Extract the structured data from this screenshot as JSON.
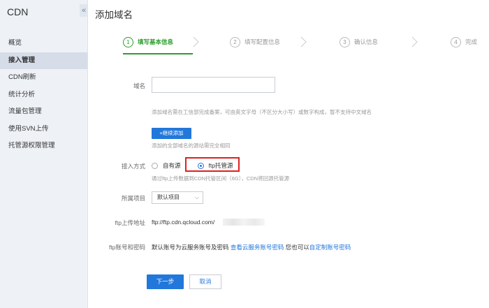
{
  "sidebar": {
    "title": "CDN",
    "collapse_glyph": "«",
    "items": [
      {
        "label": "概览"
      },
      {
        "label": "接入管理",
        "active": true
      },
      {
        "label": "CDN刷新"
      },
      {
        "label": "统计分析"
      },
      {
        "label": "流量包管理"
      },
      {
        "label": "使用SVN上传"
      },
      {
        "label": "托管源权限管理"
      }
    ]
  },
  "page": {
    "title": "添加域名"
  },
  "steps": [
    {
      "num": "1",
      "label": "填写基本信息",
      "active": true
    },
    {
      "num": "2",
      "label": "填写配置信息"
    },
    {
      "num": "3",
      "label": "确认信息"
    },
    {
      "num": "4",
      "label": "完成"
    }
  ],
  "form": {
    "domain_label": "域名",
    "domain_value": "",
    "domain_hint": "添加域名需在工信部完成备案，可由英文字母（不区分大小写）或数字构成，暂不支持中文域名",
    "add_button": "+继续添加",
    "add_hint": "添加的全部域名的源站需完全相同",
    "access_label": "接入方式",
    "access_options": [
      {
        "label": "自有源",
        "checked": false
      },
      {
        "label": "ftp托管源",
        "checked": true
      }
    ],
    "access_hint": "通过ftp上传数据到CDN托管区间（6G），CDN将回源托管源",
    "project_label": "所属项目",
    "project_value": "默认项目",
    "ftp_addr_label": "ftp上传地址",
    "ftp_addr_value": "ftp://ftp.cdn.qcloud.com/",
    "ftp_account_label": "ftp账号和密码",
    "ftp_account_text": "默认账号为云服务账号及密码",
    "ftp_account_link1": "查看云服务账号密码",
    "ftp_account_mid": "您也可以",
    "ftp_account_link2": "自定制账号密码",
    "next_button": "下一步",
    "cancel_button": "取消"
  },
  "colors": {
    "accent": "#2277da",
    "step_active": "#2a9d2a",
    "highlight": "#e02020"
  }
}
